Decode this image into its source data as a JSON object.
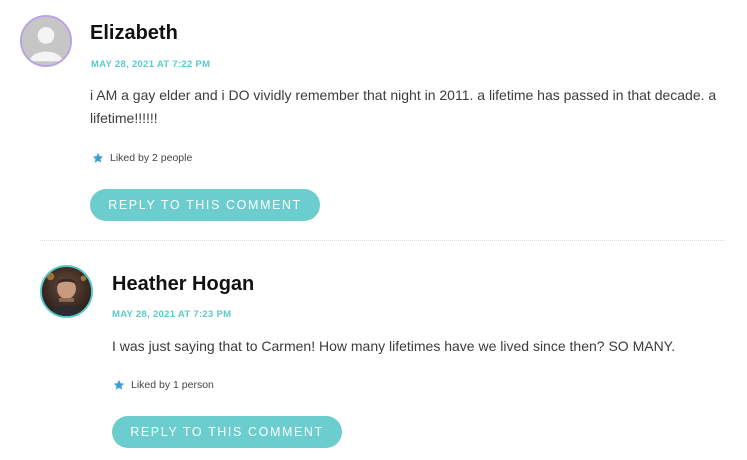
{
  "comments": [
    {
      "author": "Elizabeth",
      "date": "MAY 28, 2021 AT 7:22 PM",
      "text": "i AM a gay elder and i DO vividly remember that night in 2011. a lifetime has passed in that decade. a lifetime!!!!!!",
      "likes": "Liked by 2 people",
      "reply_label": "REPLY TO THIS COMMENT",
      "avatar_icon": "default-user-avatar-icon",
      "avatar_border_color": "#b9a3e3"
    },
    {
      "author": "Heather Hogan",
      "date": "MAY 28, 2021 AT 7:23 PM",
      "text": "I was just saying that to Carmen! How many lifetimes have we lived since then? SO MANY.",
      "likes": "Liked by 1 person",
      "reply_label": "REPLY TO THIS COMMENT",
      "avatar_icon": "user-photo-avatar",
      "avatar_border_color": "#5bc9c9"
    }
  ],
  "colors": {
    "accent": "#5bc9c9",
    "button": "#6bcdcd",
    "author": "#111111",
    "text": "#3c3c3c",
    "star": "#3a9fd6"
  }
}
